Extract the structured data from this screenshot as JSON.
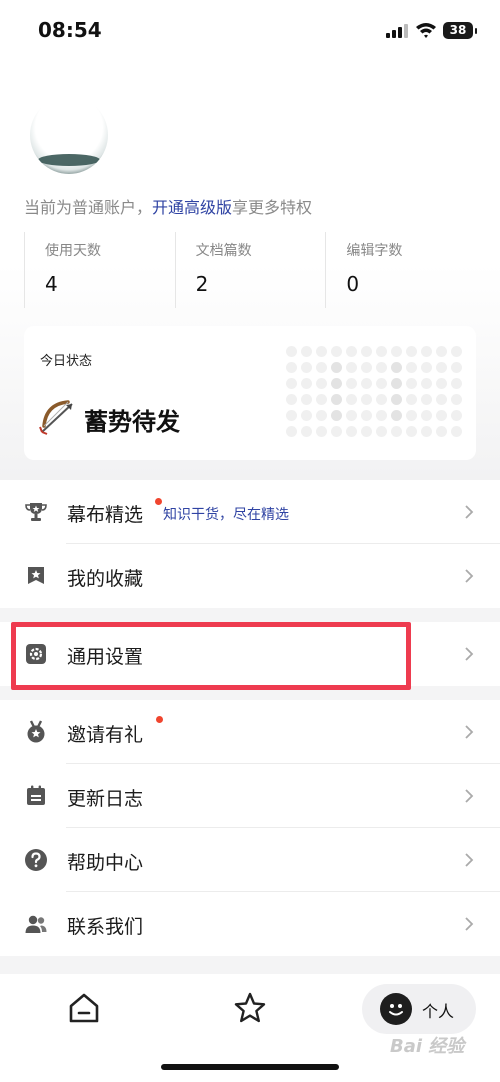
{
  "status_bar": {
    "time": "08:54",
    "battery": "38"
  },
  "account": {
    "prefix": "当前为普通账户，",
    "upgrade_link": "开通高级版",
    "suffix": "享更多特权"
  },
  "stats": [
    {
      "label": "使用天数",
      "value": "4"
    },
    {
      "label": "文档篇数",
      "value": "2"
    },
    {
      "label": "编辑字数",
      "value": "0"
    }
  ],
  "today": {
    "label": "今日状态",
    "state": "蓄势待发",
    "icon": "bow-and-arrow-icon"
  },
  "menu_group_1": [
    {
      "label": "幕布精选",
      "sub": "知识干货，尽在精选",
      "icon": "trophy-icon",
      "badge": true
    },
    {
      "label": "我的收藏",
      "icon": "star-shield-icon"
    }
  ],
  "menu_group_2": [
    {
      "label": "通用设置",
      "icon": "gear-icon"
    }
  ],
  "menu_group_3": [
    {
      "label": "邀请有礼",
      "icon": "medal-icon",
      "badge": true
    },
    {
      "label": "更新日志",
      "icon": "calendar-icon"
    },
    {
      "label": "帮助中心",
      "icon": "question-icon"
    },
    {
      "label": "联系我们",
      "icon": "contacts-icon"
    }
  ],
  "bottom_nav": {
    "me_label": "个人"
  },
  "watermark": "Bai 经验",
  "colors": {
    "accent": "#2f43a3",
    "badge": "#f0452e",
    "highlight": "#ee3b4f"
  }
}
